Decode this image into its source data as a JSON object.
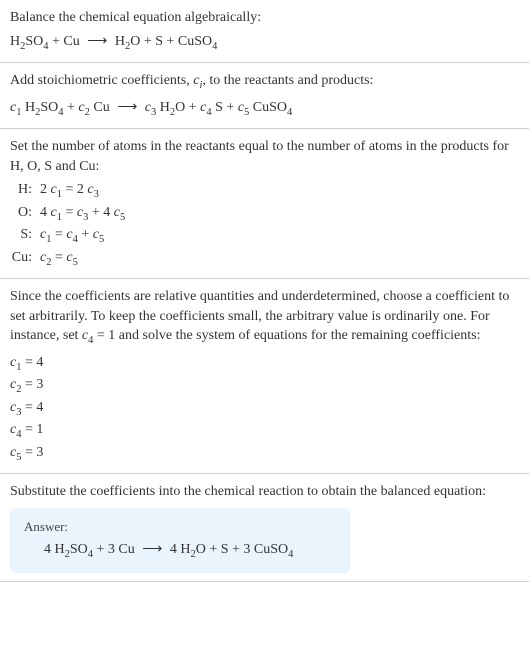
{
  "chart_data": {
    "type": "table",
    "title": "Balance chemical equation",
    "input_equation": "H2SO4 + Cu → H2O + S + CuSO4",
    "coefficients": {
      "c1": 4,
      "c2": 3,
      "c3": 4,
      "c4": 1,
      "c5": 3
    },
    "balanced_equation": "4 H2SO4 + 3 Cu → 4 H2O + S + 3 CuSO4",
    "atom_balance": [
      {
        "element": "H",
        "equation": "2 c1 = 2 c3"
      },
      {
        "element": "O",
        "equation": "4 c1 = c3 + 4 c5"
      },
      {
        "element": "S",
        "equation": "c1 = c4 + c5"
      },
      {
        "element": "Cu",
        "equation": "c2 = c5"
      }
    ]
  },
  "s1": {
    "intro": "Balance the chemical equation algebraically:",
    "r1": "H",
    "r1s": "2",
    "r2": "SO",
    "r2s": "4",
    "plus1": " + Cu ",
    "arrow": "⟶",
    "p1": " H",
    "p1s": "2",
    "p2": "O + S + CuSO",
    "p2s": "4"
  },
  "s2": {
    "intro1": "Add stoichiometric coefficients, ",
    "ci": "c",
    "cisub": "i",
    "intro2": ", to the reactants and products:",
    "c1": "c",
    "c1s": "1",
    "sp1": " H",
    "h2": "2",
    "so": "SO",
    "so4": "4",
    "plus1": " + ",
    "c2": "c",
    "c2s": "2",
    "cu": " Cu ",
    "arrow": "⟶",
    "sp2": " ",
    "c3": "c",
    "c3s": "3",
    "h2o": " H",
    "h2os": "2",
    "o": "O + ",
    "c4": "c",
    "c4s": "4",
    "s": " S + ",
    "c5": "c",
    "c5s": "5",
    "cuso": " CuSO",
    "cuso4": "4"
  },
  "s3": {
    "intro": "Set the number of atoms in the reactants equal to the number of atoms in the products for H, O, S and Cu:",
    "rows": [
      {
        "label": "H:",
        "lhs1": "2 ",
        "c1": "c",
        "c1s": "1",
        "eq": " = 2 ",
        "c2": "c",
        "c2s": "3"
      },
      {
        "label": "O:",
        "lhs1": "4 ",
        "c1": "c",
        "c1s": "1",
        "eq": " = ",
        "c2": "c",
        "c2s": "3",
        "plus": " + 4 ",
        "c3": "c",
        "c3s": "5"
      },
      {
        "label": "S:",
        "lhs1": "",
        "c1": "c",
        "c1s": "1",
        "eq": " = ",
        "c2": "c",
        "c2s": "4",
        "plus": " + ",
        "c3": "c",
        "c3s": "5"
      },
      {
        "label": "Cu:",
        "lhs1": "",
        "c1": "c",
        "c1s": "2",
        "eq": " = ",
        "c2": "c",
        "c2s": "5"
      }
    ]
  },
  "s4": {
    "intro1": "Since the coefficients are relative quantities and underdetermined, choose a coefficient to set arbitrarily. To keep the coefficients small, the arbitrary value is ordinarily one. For instance, set ",
    "c4": "c",
    "c4s": "4",
    "eq1": " = 1",
    "intro2": " and solve the system of equations for the remaining coefficients:",
    "lines": [
      {
        "c": "c",
        "cs": "1",
        "val": " = 4"
      },
      {
        "c": "c",
        "cs": "2",
        "val": " = 3"
      },
      {
        "c": "c",
        "cs": "3",
        "val": " = 4"
      },
      {
        "c": "c",
        "cs": "4",
        "val": " = 1"
      },
      {
        "c": "c",
        "cs": "5",
        "val": " = 3"
      }
    ]
  },
  "s5": {
    "intro": "Substitute the coefficients into the chemical reaction to obtain the balanced equation:",
    "answer_label": "Answer:",
    "eq": {
      "a": "4 H",
      "as": "2",
      "b": "SO",
      "bs": "4",
      "plus": " + 3 Cu ",
      "arrow": "⟶",
      "c": " 4 H",
      "cs": "2",
      "d": "O + S + 3 CuSO",
      "ds": "4"
    }
  }
}
